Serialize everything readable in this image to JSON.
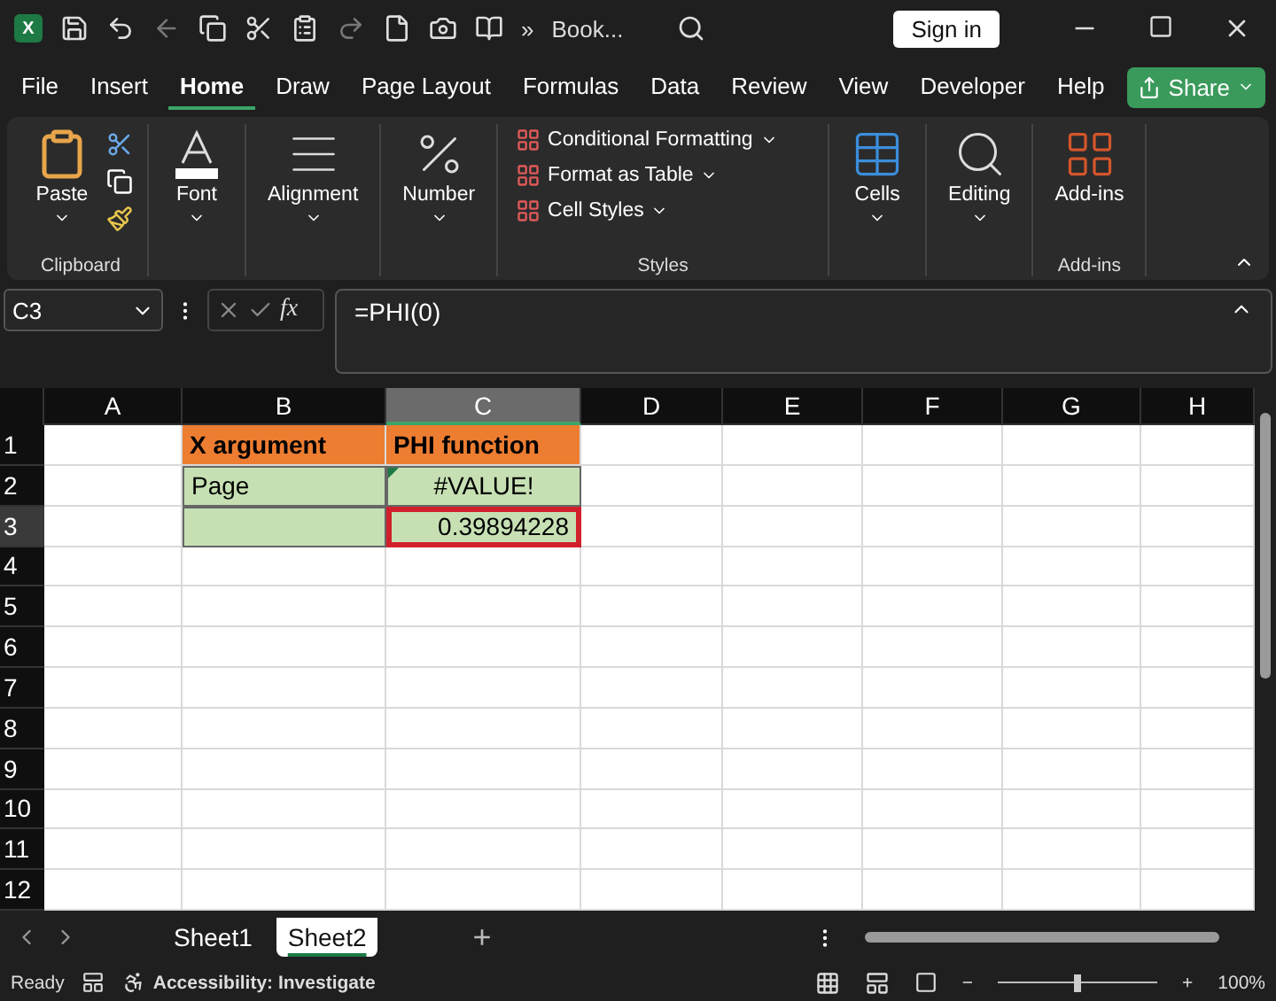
{
  "title_bar": {
    "logo_letter": "X",
    "overflow": "»",
    "doc_title": "Book...",
    "sign_in": "Sign in"
  },
  "menu_tabs": [
    {
      "label": "File",
      "selected": false
    },
    {
      "label": "Insert",
      "selected": false
    },
    {
      "label": "Home",
      "selected": true
    },
    {
      "label": "Draw",
      "selected": false
    },
    {
      "label": "Page Layout",
      "selected": false
    },
    {
      "label": "Formulas",
      "selected": false
    },
    {
      "label": "Data",
      "selected": false
    },
    {
      "label": "Review",
      "selected": false
    },
    {
      "label": "View",
      "selected": false
    },
    {
      "label": "Developer",
      "selected": false
    },
    {
      "label": "Help",
      "selected": false
    }
  ],
  "share_button": "Share",
  "ribbon": {
    "groups": [
      {
        "kind": "clipboard",
        "label": "Clipboard",
        "buttons": [
          "Paste"
        ]
      },
      {
        "kind": "font",
        "buttons": [
          "Font"
        ]
      },
      {
        "kind": "alignment",
        "buttons": [
          "Alignment"
        ]
      },
      {
        "kind": "number",
        "buttons": [
          "Number"
        ]
      },
      {
        "kind": "styles",
        "label": "Styles",
        "buttons": [
          "Conditional Formatting",
          "Format as Table",
          "Cell Styles"
        ]
      },
      {
        "kind": "cells",
        "buttons": [
          "Cells"
        ]
      },
      {
        "kind": "editing",
        "buttons": [
          "Editing"
        ]
      },
      {
        "kind": "addins",
        "label": "Add-ins",
        "buttons": [
          "Add-ins"
        ]
      }
    ]
  },
  "formula_bar": {
    "name_box": "C3",
    "fx": "fx",
    "formula": "=PHI(0)"
  },
  "grid": {
    "columns": [
      {
        "label": "A",
        "selected": false
      },
      {
        "label": "B",
        "selected": false
      },
      {
        "label": "C",
        "selected": true
      },
      {
        "label": "D",
        "selected": false
      },
      {
        "label": "E",
        "selected": false
      },
      {
        "label": "F",
        "selected": false
      },
      {
        "label": "G",
        "selected": false
      },
      {
        "label": "H",
        "selected": false
      }
    ],
    "rows": [
      {
        "number": "1",
        "selected": false,
        "cells": [
          {
            "kind": "plain"
          },
          {
            "kind": "header",
            "text": "X argument"
          },
          {
            "kind": "header",
            "text": "PHI function"
          }
        ]
      },
      {
        "number": "2",
        "selected": false,
        "cells": [
          {
            "kind": "plain"
          },
          {
            "kind": "text",
            "text": "Page"
          },
          {
            "kind": "error",
            "text": "#VALUE!"
          }
        ]
      },
      {
        "number": "3",
        "selected": true,
        "cells": [
          {
            "kind": "plain"
          },
          {
            "kind": "fill"
          },
          {
            "kind": "number",
            "selected": true,
            "text": "0.39894228"
          }
        ]
      },
      {
        "number": "4",
        "selected": false
      },
      {
        "number": "5",
        "selected": false
      },
      {
        "number": "6",
        "selected": false
      },
      {
        "number": "7",
        "selected": false
      },
      {
        "number": "8",
        "selected": false
      },
      {
        "number": "9",
        "selected": false
      },
      {
        "number": "10",
        "selected": false
      },
      {
        "number": "11",
        "selected": false
      },
      {
        "number": "12",
        "selected": false
      }
    ]
  },
  "sheet_tabs": [
    {
      "label": "Sheet1",
      "selected": false
    },
    {
      "label": "Sheet2",
      "selected": true
    }
  ],
  "add_sheet": "+",
  "status_bar": {
    "status": "Ready",
    "accessibility": "Accessibility: Investigate",
    "zoom_out": "−",
    "zoom_in": "+",
    "zoom": {
      "level": 0.5
    },
    "zoom_label": "100%"
  }
}
